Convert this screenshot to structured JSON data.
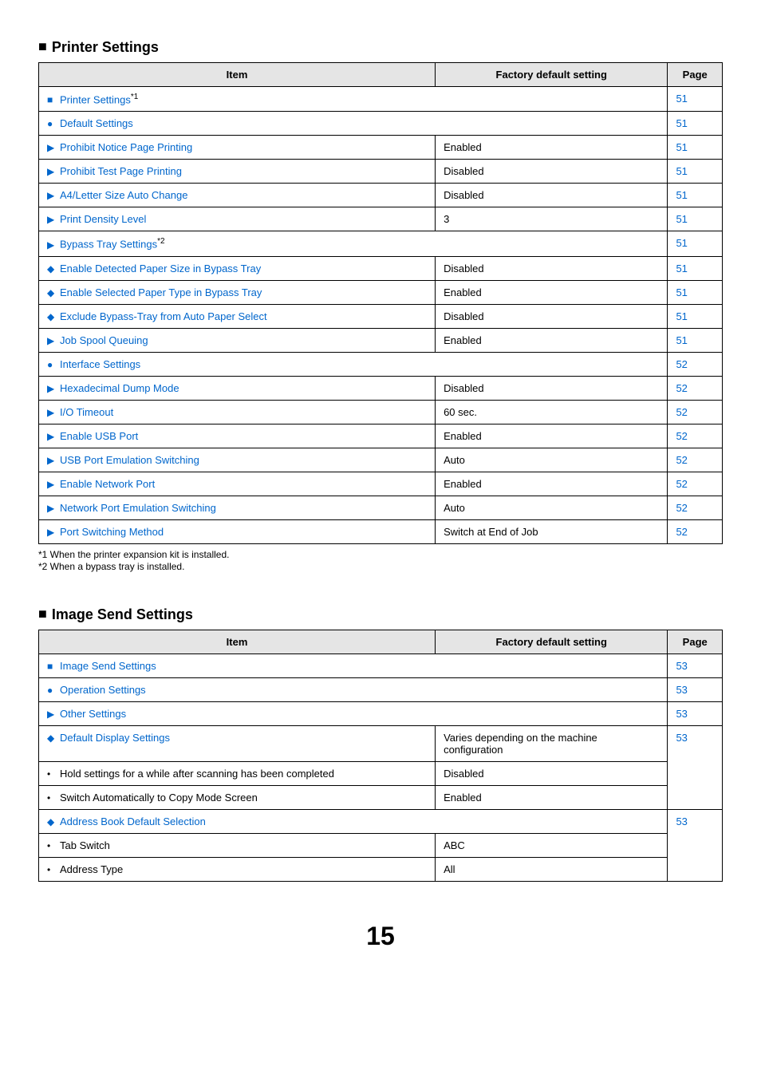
{
  "printer_settings": {
    "heading": "Printer Settings",
    "columns": {
      "item": "Item",
      "factory": "Factory default setting",
      "page": "Page"
    },
    "footnotes": [
      "*1  When the printer expansion kit is installed.",
      "*2  When a bypass tray is installed."
    ],
    "rows": [
      {
        "mark": "square",
        "indent": 0,
        "label": "Printer Settings",
        "sup": "*1",
        "link": true,
        "factory": "",
        "factory_span": true,
        "page": "51",
        "page_link": true
      },
      {
        "mark": "bullet",
        "indent": 1,
        "label": "Default Settings",
        "link": true,
        "factory": "",
        "factory_span": true,
        "page": "51",
        "page_link": true
      },
      {
        "mark": "tri",
        "indent": 2,
        "label": "Prohibit Notice Page Printing",
        "link": true,
        "factory": "Enabled",
        "page": "51",
        "page_link": true
      },
      {
        "mark": "tri",
        "indent": 2,
        "label": "Prohibit Test Page Printing",
        "link": true,
        "factory": "Disabled",
        "page": "51",
        "page_link": true
      },
      {
        "mark": "tri",
        "indent": 2,
        "label": "A4/Letter Size Auto Change",
        "link": true,
        "factory": "Disabled",
        "page": "51",
        "page_link": true
      },
      {
        "mark": "tri",
        "indent": 2,
        "label": "Print Density Level",
        "link": true,
        "factory": "3",
        "page": "51",
        "page_link": true
      },
      {
        "mark": "tri",
        "indent": 2,
        "label": "Bypass Tray Settings",
        "sup": "*2",
        "link": true,
        "factory": "",
        "factory_span": true,
        "page": "51",
        "page_link": true
      },
      {
        "mark": "diamond",
        "indent": 3,
        "label": "Enable Detected Paper Size in Bypass Tray",
        "link": true,
        "factory": "Disabled",
        "page": "51",
        "page_link": true
      },
      {
        "mark": "diamond",
        "indent": 3,
        "label": "Enable Selected Paper Type in Bypass Tray",
        "link": true,
        "factory": "Enabled",
        "page": "51",
        "page_link": true
      },
      {
        "mark": "diamond",
        "indent": 3,
        "label": "Exclude Bypass-Tray from Auto Paper Select",
        "link": true,
        "factory": "Disabled",
        "page": "51",
        "page_link": true
      },
      {
        "mark": "tri",
        "indent": 2,
        "label": "Job Spool Queuing",
        "link": true,
        "factory": "Enabled",
        "page": "51",
        "page_link": true
      },
      {
        "mark": "bullet",
        "indent": 1,
        "label": "Interface Settings",
        "link": true,
        "factory": "",
        "factory_span": true,
        "page": "52",
        "page_link": true
      },
      {
        "mark": "tri",
        "indent": 2,
        "label": "Hexadecimal Dump Mode",
        "link": true,
        "factory": "Disabled",
        "page": "52",
        "page_link": true
      },
      {
        "mark": "tri",
        "indent": 2,
        "label": "I/O Timeout",
        "link": true,
        "factory": "60 sec.",
        "page": "52",
        "page_link": true
      },
      {
        "mark": "tri",
        "indent": 2,
        "label": "Enable USB Port",
        "link": true,
        "factory": "Enabled",
        "page": "52",
        "page_link": true
      },
      {
        "mark": "tri",
        "indent": 2,
        "label": "USB Port Emulation Switching",
        "link": true,
        "factory": "Auto",
        "page": "52",
        "page_link": true
      },
      {
        "mark": "tri",
        "indent": 2,
        "label": "Enable Network Port",
        "link": true,
        "factory": "Enabled",
        "page": "52",
        "page_link": true
      },
      {
        "mark": "tri",
        "indent": 2,
        "label": "Network Port Emulation Switching",
        "link": true,
        "factory": "Auto",
        "page": "52",
        "page_link": true
      },
      {
        "mark": "tri",
        "indent": 2,
        "label": "Port Switching Method",
        "link": true,
        "factory": "Switch at End of Job",
        "page": "52",
        "page_link": true
      }
    ]
  },
  "image_send_settings": {
    "heading": "Image Send Settings",
    "columns": {
      "item": "Item",
      "factory": "Factory default setting",
      "page": "Page"
    },
    "rows": [
      {
        "mark": "square",
        "indent": 0,
        "label": "Image Send Settings",
        "link": true,
        "factory": "",
        "factory_span": true,
        "page": "53",
        "page_link": true
      },
      {
        "mark": "bullet",
        "indent": 1,
        "label": "Operation Settings",
        "link": true,
        "factory": "",
        "factory_span": true,
        "page": "53",
        "page_link": true
      },
      {
        "mark": "tri",
        "indent": 2,
        "label": "Other Settings",
        "link": true,
        "factory": "",
        "factory_span": true,
        "page": "53",
        "page_link": true
      },
      {
        "mark": "diamond",
        "indent": 3,
        "label": "Default Display Settings",
        "link": true,
        "factory": "Varies depending on the machine configuration",
        "page_group_start": true,
        "page_group_span": 3,
        "page": "53",
        "page_link": true
      },
      {
        "mark": "dot",
        "indent": "3b",
        "label": "Hold settings for a while after scanning has been completed",
        "link": false,
        "factory": "Disabled"
      },
      {
        "mark": "dot",
        "indent": "3b",
        "label": "Switch Automatically to Copy Mode Screen",
        "link": false,
        "factory": "Enabled"
      },
      {
        "mark": "diamond",
        "indent": 3,
        "label": "Address Book Default Selection",
        "link": true,
        "factory": "",
        "factory_span": true,
        "page_group_start": true,
        "page_group_span": 3,
        "page": "53",
        "page_link": true
      },
      {
        "mark": "dot",
        "indent": "3b",
        "label": "Tab Switch",
        "link": false,
        "factory": "ABC"
      },
      {
        "mark": "dot",
        "indent": "3b",
        "label": "Address Type",
        "link": false,
        "factory": "All"
      }
    ]
  },
  "page_number": "15"
}
